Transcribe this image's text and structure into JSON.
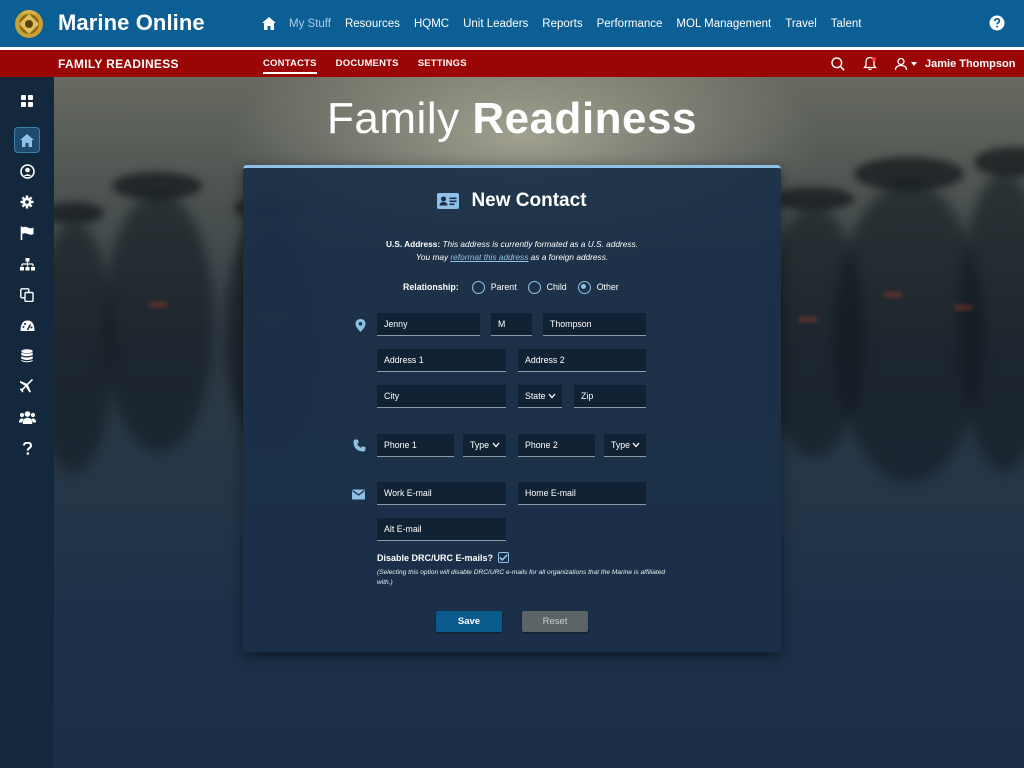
{
  "app": {
    "title": "Marine Online"
  },
  "topnav": {
    "items": [
      {
        "label": "My Stuff",
        "active": true
      },
      {
        "label": "Resources"
      },
      {
        "label": "HQMC"
      },
      {
        "label": "Unit Leaders"
      },
      {
        "label": "Reports"
      },
      {
        "label": "Performance"
      },
      {
        "label": "MOL Management"
      },
      {
        "label": "Travel"
      },
      {
        "label": "Talent"
      }
    ],
    "home_icon": "home-icon",
    "help_icon": "help-circle-icon"
  },
  "subbar": {
    "section_title": "FAMILY READINESS",
    "tabs": [
      {
        "label": "CONTACTS",
        "active": true
      },
      {
        "label": "DOCUMENTS"
      },
      {
        "label": "SETTINGS"
      }
    ],
    "user_name": "Jamie Thompson",
    "icons": [
      "search-icon",
      "bell-alert-icon",
      "user-icon",
      "caret-down-icon"
    ]
  },
  "sidebar": {
    "icons": [
      "apps-grid-icon",
      "home-icon",
      "user-circle-icon",
      "gear-icon",
      "flag-icon",
      "org-chart-icon",
      "copy-icon",
      "dashboard-gauge-icon",
      "database-icon",
      "airplane-icon",
      "users-icon",
      "question-icon"
    ],
    "active": "home-icon"
  },
  "page": {
    "heading_light": "Family",
    "heading_bold": "Readiness"
  },
  "form": {
    "title": "New Contact",
    "address_note": {
      "label": "U.S. Address:",
      "text1": " This address is currently formated as a U.S. address.",
      "text2_pre": "You may ",
      "link": "reformat this address",
      "text2_post": " as a foreign address."
    },
    "relationship": {
      "label": "Relationship:",
      "options": [
        "Parent",
        "Child",
        "Other"
      ],
      "selected": "Other"
    },
    "fields": {
      "first_name": "Jenny",
      "middle_initial": "M",
      "last_name": "Thompson",
      "address1": "Address 1",
      "address2": "Address 2",
      "city": "City",
      "state": "State",
      "zip": "Zip",
      "phone1": "Phone 1",
      "phone1_type": "Type",
      "phone2": "Phone 2",
      "phone2_type": "Type",
      "work_email": "Work E-mail",
      "home_email": "Home E-mail",
      "alt_email": "Alt E-mail"
    },
    "disable_emails": {
      "label": "Disable DRC/URC E-mails?",
      "checked": true,
      "note": "(Selecting this option will disable DRC/URC e-mails for all organizations that the Marine is affiliated with.)"
    },
    "buttons": {
      "save": "Save",
      "reset": "Reset"
    }
  },
  "colors": {
    "topbar": "#0c5f95",
    "subbar": "#9a0505",
    "accent": "#8fc0e6",
    "card": "#1b3047",
    "save": "#0b5a8e",
    "reset": "#5d6468"
  }
}
